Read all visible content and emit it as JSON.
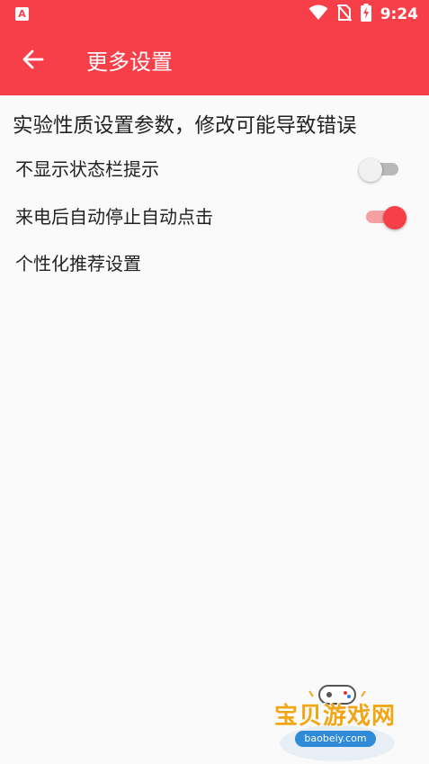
{
  "status_bar": {
    "app_icon": "app-notification-icon",
    "icons": [
      "wifi-icon",
      "no-sim-icon",
      "battery-charging-icon"
    ],
    "time": "9:24"
  },
  "header": {
    "back_icon": "arrow-back-icon",
    "title": "更多设置",
    "color": "#f73f49"
  },
  "settings": {
    "warning": "实验性质设置参数，修改可能导致错误",
    "items": [
      {
        "label": "不显示状态栏提示",
        "toggle": "off"
      },
      {
        "label": "来电后自动停止自动点击",
        "toggle": "on"
      },
      {
        "label": "个性化推荐设置"
      }
    ]
  },
  "watermark": {
    "text": "宝贝游戏网",
    "url": "baobeiy.com"
  }
}
